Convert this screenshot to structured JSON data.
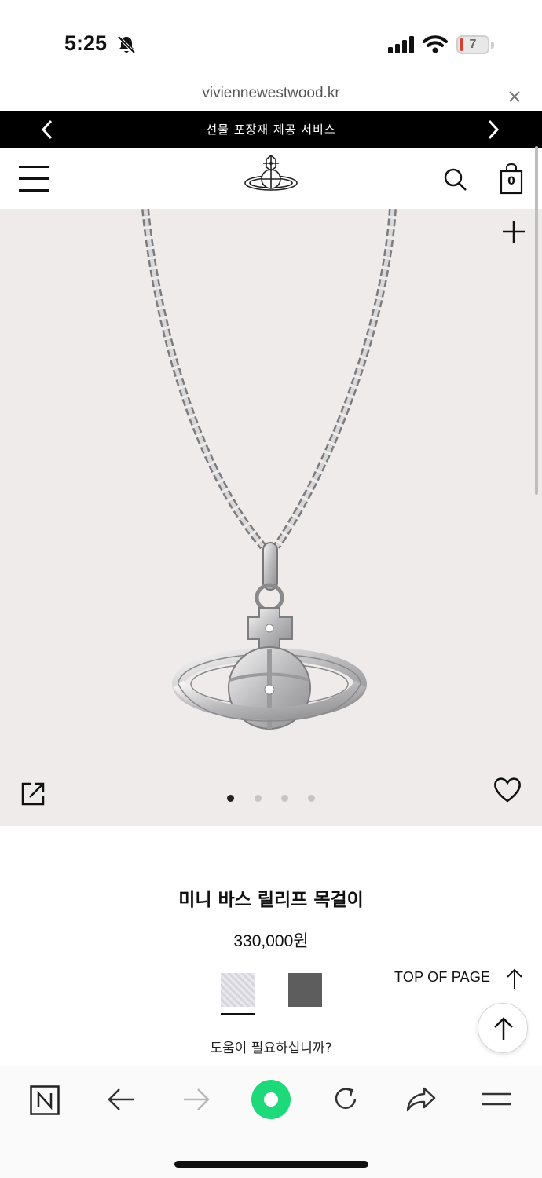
{
  "status_bar": {
    "time": "5:25",
    "battery_level": "7",
    "icons": [
      "bell-slash-icon",
      "signal-icon",
      "wifi-icon",
      "battery-icon"
    ]
  },
  "browser": {
    "url": "viviennewestwood.kr",
    "close_icon": "close-icon"
  },
  "promo_banner": {
    "text": "선물 포장재 제공 서비스",
    "prev_icon": "chevron-left-icon",
    "next_icon": "chevron-right-icon"
  },
  "header": {
    "menu_icon": "hamburger-menu-icon",
    "logo": "orb-logo",
    "search_icon": "search-icon",
    "cart_count": "0"
  },
  "gallery": {
    "zoom_icon": "plus-icon",
    "share_icon": "share-icon",
    "wishlist_icon": "heart-icon",
    "slide_count": 4,
    "active_slide": 1
  },
  "product": {
    "name": "미니 바스 릴리프 목걸이",
    "price": "330,000원",
    "swatches": [
      {
        "name": "silver",
        "color": "#dcdce2",
        "selected": true
      },
      {
        "name": "gunmetal",
        "color": "#5d5d5d",
        "selected": false
      }
    ],
    "help_text": "도움이 필요하십니까?"
  },
  "top_of_page": {
    "label": "TOP OF PAGE"
  },
  "browser_toolbar": {
    "items": [
      "naver-n-icon",
      "back-arrow-icon",
      "forward-arrow-icon",
      "green-circle-icon",
      "reload-icon",
      "share-arrow-icon",
      "menu-icon"
    ],
    "accent": "#1ed97a"
  }
}
